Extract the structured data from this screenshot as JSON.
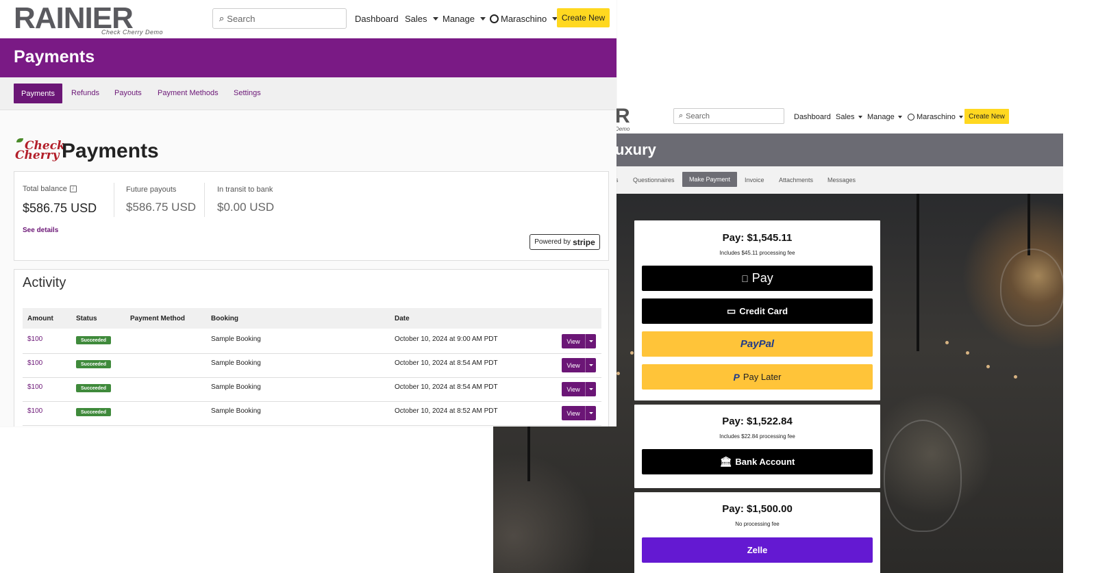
{
  "admin": {
    "logo": {
      "main": "RAINIER",
      "sub": "Check Cherry Demo"
    },
    "search_placeholder": "Search",
    "nav": {
      "dashboard": "Dashboard",
      "sales": "Sales",
      "manage": "Manage",
      "user": "Maraschino"
    },
    "create_new": "Create New",
    "banner_title": "Payments",
    "tabs": [
      "Payments",
      "Refunds",
      "Payouts",
      "Payment Methods",
      "Settings"
    ],
    "brand_logo": {
      "line1": "Check",
      "line2": "Cherry"
    },
    "page_title": "Payments",
    "balance": {
      "total_label": "Total balance",
      "total_value": "$586.75 USD",
      "future_label": "Future payouts",
      "future_value": "$586.75 USD",
      "transit_label": "In transit to bank",
      "transit_value": "$0.00 USD",
      "see_details": "See details",
      "powered_by": "Powered by",
      "stripe": "stripe"
    },
    "activity": {
      "title": "Activity",
      "columns": [
        "Amount",
        "Status",
        "Payment Method",
        "Booking",
        "Date"
      ],
      "rows": [
        {
          "amount": "$100",
          "status": "Succeeded",
          "method": "",
          "booking": "Sample Booking",
          "date": "October 10, 2024 at 9:00 AM PDT",
          "action": "View"
        },
        {
          "amount": "$100",
          "status": "Succeeded",
          "method": "",
          "booking": "Sample Booking",
          "date": "October 10, 2024 at 8:54 AM PDT",
          "action": "View"
        },
        {
          "amount": "$100",
          "status": "Succeeded",
          "method": "",
          "booking": "Sample Booking",
          "date": "October 10, 2024 at 8:54 AM PDT",
          "action": "View"
        },
        {
          "amount": "$100",
          "status": "Succeeded",
          "method": "",
          "booking": "Sample Booking",
          "date": "October 10, 2024 at 8:52 AM PDT",
          "action": "View"
        }
      ]
    }
  },
  "client": {
    "logo_partial": "R",
    "logo_sub_partial": "Demo",
    "search_placeholder": "Search",
    "nav": {
      "dashboard": "Dashboard",
      "sales": "Sales",
      "manage": "Manage",
      "user": "Maraschino"
    },
    "create_new": "Create New",
    "banner_title_partial": "uxury",
    "tabs": {
      "partial": "s",
      "questionnaires": "Questionnaires",
      "make_payment": "Make Payment",
      "invoice": "Invoice",
      "attachments": "Attachments",
      "messages": "Messages"
    },
    "cards": [
      {
        "title": "Pay: $1,545.11",
        "fee": "Includes $45.11 processing fee",
        "buttons": [
          {
            "label": "Pay",
            "icon": "apple-icon"
          },
          {
            "label": "Credit Card",
            "icon": "credit-card-icon"
          },
          {
            "label": "PayPal",
            "icon": ""
          },
          {
            "label": "Pay Later",
            "icon": "paypal-icon"
          }
        ]
      },
      {
        "title": "Pay: $1,522.84",
        "fee": "Includes $22.84 processing fee",
        "buttons": [
          {
            "label": "Bank Account",
            "icon": "bank-icon"
          }
        ]
      },
      {
        "title": "Pay: $1,500.00",
        "fee": "No processing fee",
        "buttons": [
          {
            "label": "Zelle",
            "icon": ""
          }
        ]
      }
    ]
  },
  "colors": {
    "brand_purple": "#7a1a85",
    "accent_yellow": "#ffd820",
    "success_green": "#3f8a3b",
    "paypal_yellow": "#ffc439",
    "zelle_purple": "#6419d2"
  }
}
